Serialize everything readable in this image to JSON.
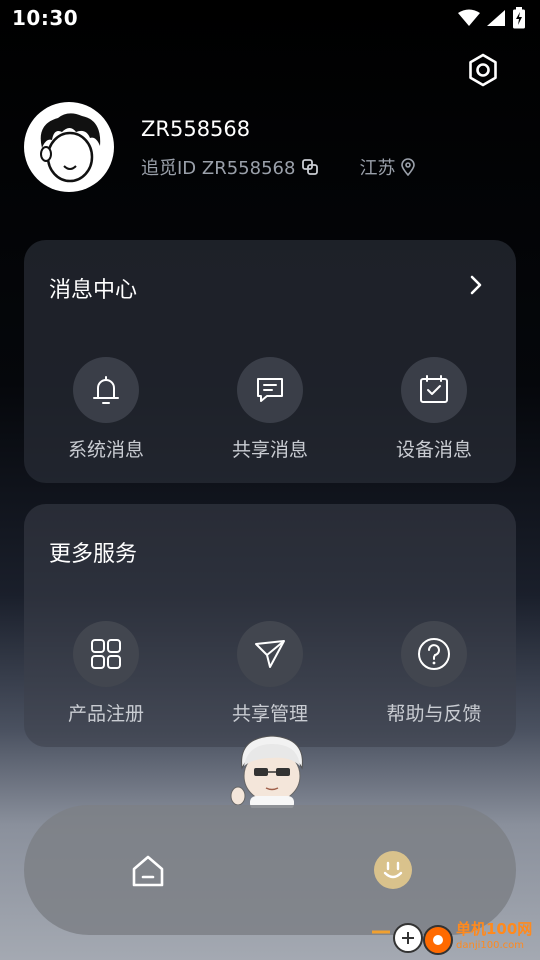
{
  "status_bar": {
    "time": "10:30",
    "icons": [
      "wifi-icon",
      "signal-icon",
      "battery-charging-icon"
    ]
  },
  "header": {
    "settings_icon": "gear-icon",
    "username": "ZR558568",
    "id_text": "追觅ID ZR558568",
    "region": "江苏"
  },
  "message_center": {
    "title": "消息中心",
    "items": [
      {
        "label": "系统消息",
        "icon": "bell-icon"
      },
      {
        "label": "共享消息",
        "icon": "chat-icon"
      },
      {
        "label": "设备消息",
        "icon": "calendar-check-icon"
      }
    ]
  },
  "more_services": {
    "title": "更多服务",
    "items": [
      {
        "label": "产品注册",
        "icon": "grid-icon"
      },
      {
        "label": "共享管理",
        "icon": "send-icon"
      },
      {
        "label": "帮助与反馈",
        "icon": "question-icon"
      }
    ]
  },
  "tabbar": {
    "tabs": [
      {
        "icon": "home-icon"
      },
      {
        "icon": "smile-face-icon"
      }
    ]
  },
  "watermark": {
    "line1": "单机100网",
    "line2": "danji100.com"
  },
  "colors": {
    "card_bg": "#282c36",
    "icon_circle": "#3a3e48",
    "secondary_text": "#9aa0aa",
    "accent_yellow": "#d9c28c"
  }
}
